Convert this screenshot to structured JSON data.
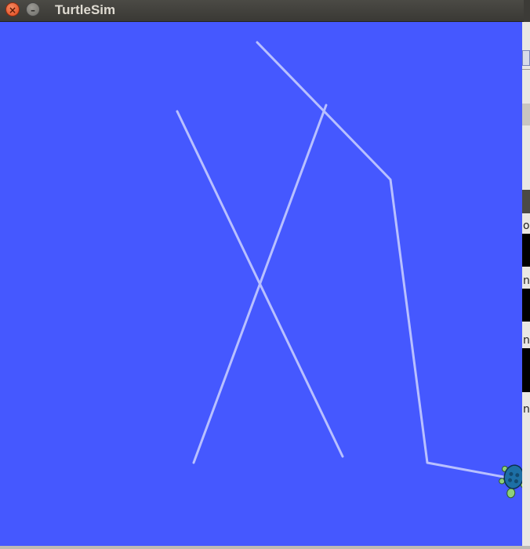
{
  "window": {
    "title": "TurtleSim",
    "close_glyph": "×",
    "minimize_glyph": "–"
  },
  "canvas": {
    "background_color": "#4558ff",
    "pen_color": "#b8c0ff"
  },
  "turtle": {
    "icon": "turtle-icon",
    "shell_color": "#1d6fa5",
    "body_color": "#8fcf7a"
  },
  "background_window": {
    "fragments": [
      "o",
      "n",
      "n",
      "ns"
    ]
  }
}
